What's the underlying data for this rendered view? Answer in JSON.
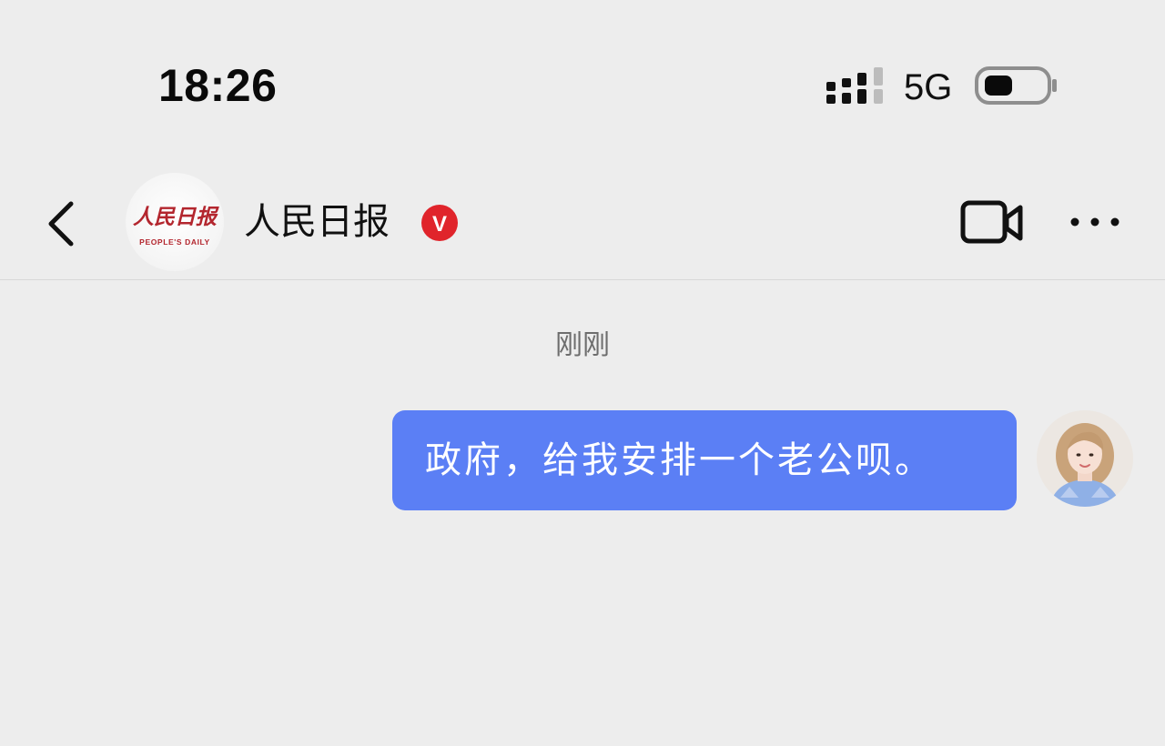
{
  "status_bar": {
    "time": "18:26",
    "network": "5G",
    "signal_icon": "cellular-signal-icon",
    "battery_icon": "battery-icon"
  },
  "header": {
    "back_icon": "chevron-left-icon",
    "logo_text": "人民日报",
    "logo_subtext": "PEOPLE'S DAILY",
    "name": "人民日报",
    "verified_badge": "V",
    "video_icon": "video-camera-icon",
    "more_icon": "ellipsis-icon"
  },
  "conversation": {
    "timestamp": "刚刚",
    "messages": [
      {
        "sender": "self",
        "text": "政府，给我安排一个老公呗。"
      }
    ]
  },
  "colors": {
    "background": "#ededed",
    "bubble": "#5b7ff5",
    "bubble_text": "#ffffff",
    "verified": "#e0242b",
    "logo_red": "#b3262e",
    "timestamp_text": "#6d6d6d"
  }
}
